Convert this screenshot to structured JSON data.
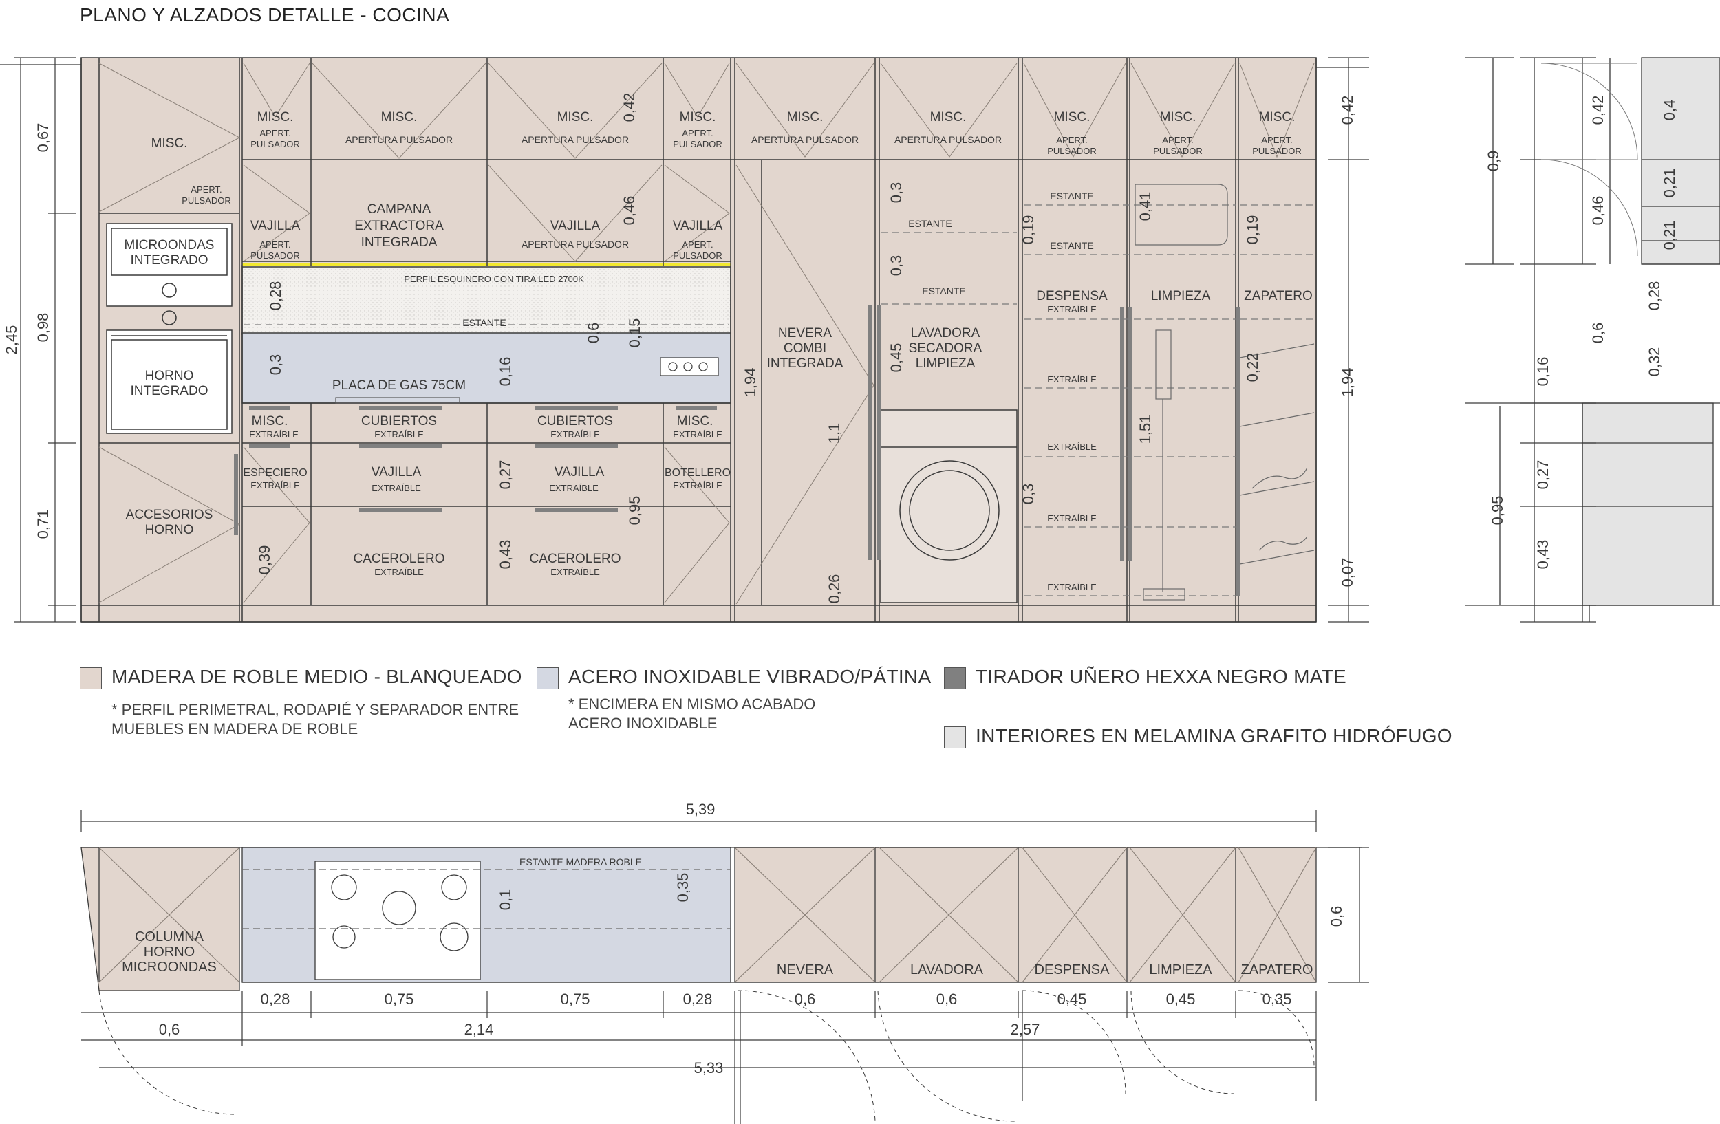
{
  "title": "PLANO Y ALZADOS DETALLE - COCINA",
  "colors": {
    "oak": "#e2d6ce",
    "steel": "#d4d8e2",
    "graphite": "#e4e4e4",
    "handle": "#808080",
    "led": "#f2e830",
    "line": "#3a3a3a"
  },
  "elevation": {
    "dims_left": [
      "2,45",
      "0,67",
      "0,98",
      "0,71"
    ],
    "dims_right": [
      "0,42",
      "1,94",
      "0,07"
    ],
    "labels": {
      "misc": "MISC.",
      "apert_pulsador_1": "APERT.",
      "apert_pulsador_2": "PULSADOR",
      "apertura_pulsador": "APERTURA PULSADOR",
      "microondas_1": "MICROONDAS",
      "microondas_2": "INTEGRADO",
      "horno_1": "HORNO",
      "horno_2": "INTEGRADO",
      "accesorios_1": "ACCESORIOS",
      "accesorios_2": "HORNO",
      "vajilla": "VAJILLA",
      "campana_1": "CAMPANA",
      "campana_2": "EXTRACTORA",
      "campana_3": "INTEGRADA",
      "perfil": "PERFIL ESQUINERO CON TIRA LED 2700K",
      "estante": "ESTANTE",
      "placa": "PLACA DE GAS 75CM",
      "cubiertos": "CUBIERTOS",
      "extraible": "EXTRAÍBLE",
      "especiero": "ESPECIERO",
      "cacerolero": "CACEROLERO",
      "botellero": "BOTELLERO",
      "nevera_1": "NEVERA",
      "nevera_2": "COMBI",
      "nevera_3": "INTEGRADA",
      "lavadora_1": "LAVADORA",
      "lavadora_2": "SECADORA",
      "lavadora_3": "LIMPIEZA",
      "despensa": "DESPENSA",
      "limpieza": "LIMPIEZA",
      "zapatero": "ZAPATERO"
    },
    "inner_dims": {
      "d028": "0,28",
      "d03": "0,3",
      "d042": "0,42",
      "d046": "0,46",
      "d06": "0,6",
      "d015": "0,15",
      "d016": "0,16",
      "d027": "0,27",
      "d043": "0,43",
      "d095": "0,95",
      "d039": "0,39",
      "d194": "1,94",
      "d11": "1,1",
      "d026": "0,26",
      "d03b": "0,3",
      "d03c": "0,3",
      "d045": "0,45",
      "d019": "0,19",
      "d041": "0,41",
      "d151": "1,51",
      "d03d": "0,3",
      "d019b": "0,19",
      "d022": "0,22"
    }
  },
  "section": {
    "dims_left": [
      "0,9",
      "0,42",
      "0,46",
      "0,6",
      "0,16",
      "0,95",
      "0,27",
      "0,43"
    ],
    "dims_inner": [
      "0,4",
      "0,21",
      "0,21",
      "0,28",
      "0,32"
    ]
  },
  "legend": {
    "oak": "MADERA DE ROBLE MEDIO - BLANQUEADO",
    "oak_note_1": "* PERFIL PERIMETRAL, RODAPIÉ Y SEPARADOR ENTRE",
    "oak_note_2": "MUEBLES EN MADERA DE ROBLE",
    "steel": "ACERO INOXIDABLE VIBRADO/PÁTINA",
    "steel_note_1": "* ENCIMERA EN MISMO ACABADO",
    "steel_note_2": "ACERO INOXIDABLE",
    "handle": "TIRADOR UÑERO HEXXA NEGRO MATE",
    "graphite": "INTERIORES EN MELAMINA GRAFITO HIDRÓFUGO"
  },
  "plan": {
    "total_top": "5,39",
    "estante_label": "ESTANTE MADERA ROBLE",
    "d01": "0,1",
    "d035": "0,35",
    "d06_right": "0,6",
    "columna_1": "COLUMNA",
    "columna_2": "HORNO",
    "columna_3": "MICROONDAS",
    "modules": [
      "NEVERA",
      "LAVADORA",
      "DESPENSA",
      "LIMPIEZA",
      "ZAPATERO"
    ],
    "widths_row1": [
      "0,28",
      "0,75",
      "0,75",
      "0,28",
      "0,6",
      "0,6",
      "0,45",
      "0,45",
      "0,35"
    ],
    "row2_left": "0,6",
    "row2_mid": "2,14",
    "row2_right": "2,57",
    "row3_total": "5,33"
  }
}
